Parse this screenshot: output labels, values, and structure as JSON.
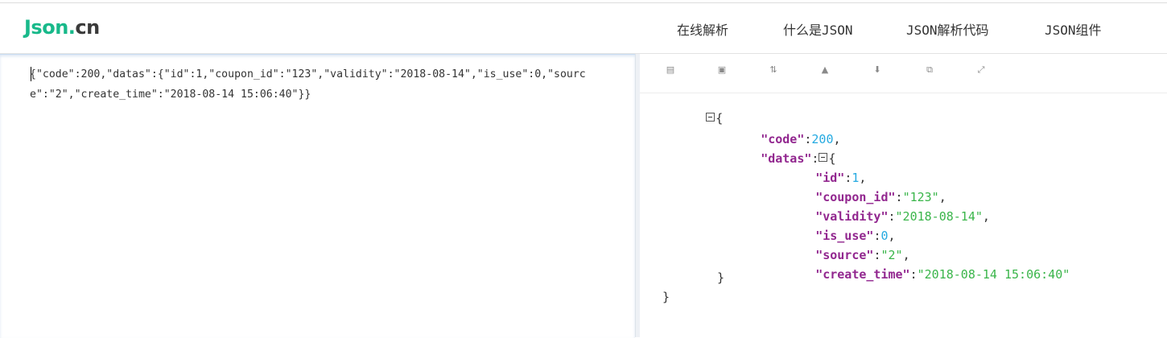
{
  "header": {
    "logo_main": "Json",
    "logo_dot": ".",
    "logo_tld": "cn",
    "nav": [
      "在线解析",
      "什么是JSON",
      "JSON解析代码",
      "JSON组件"
    ]
  },
  "editor": {
    "raw_text": "{\"code\":200,\"datas\":{\"id\":1,\"coupon_id\":\"123\",\"validity\":\"2018-08-14\",\"is_use\":0,\"source\":\"2\",\"create_time\":\"2018-08-14 15:06:40\"}}"
  },
  "toolbar": {
    "icons": [
      "format-icon",
      "save-icon",
      "sort-icon",
      "delete-icon",
      "download-icon",
      "copy-icon",
      "compress-icon"
    ]
  },
  "tree": {
    "open_brace": "{",
    "close_brace": "}",
    "code_key": "\"code\"",
    "code_val": "200",
    "datas_key": "\"datas\"",
    "id_key": "\"id\"",
    "id_val": "1",
    "coupon_key": "\"coupon_id\"",
    "coupon_val": "\"123\"",
    "validity_key": "\"validity\"",
    "validity_val": "\"2018-08-14\"",
    "is_use_key": "\"is_use\"",
    "is_use_val": "0",
    "source_key": "\"source\"",
    "source_val": "\"2\"",
    "create_key": "\"create_time\"",
    "create_val": "\"2018-08-14 15:06:40\""
  },
  "colors": {
    "brand": "#18b98a",
    "json_key": "#92278f",
    "json_number": "#25aae1",
    "json_string": "#3ab54a"
  }
}
